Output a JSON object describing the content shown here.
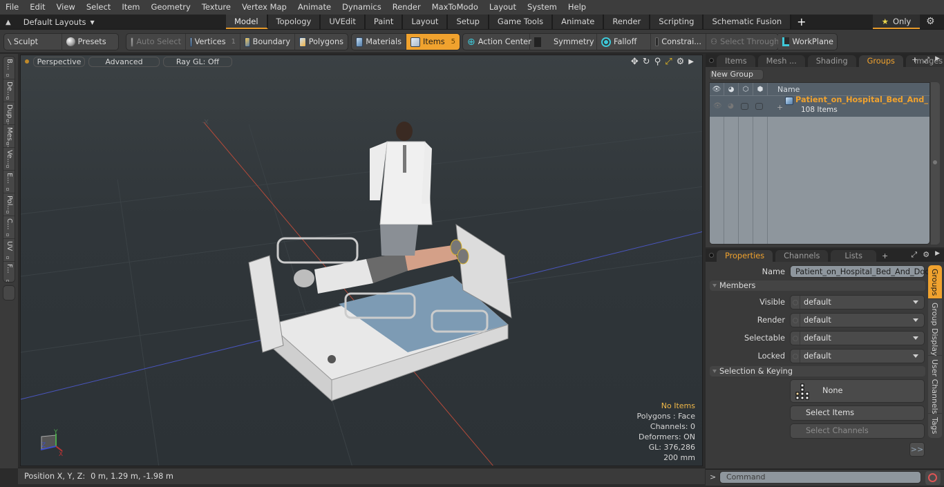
{
  "menu": [
    "File",
    "Edit",
    "View",
    "Select",
    "Item",
    "Geometry",
    "Texture",
    "Vertex Map",
    "Animate",
    "Dynamics",
    "Render",
    "MaxToModo",
    "Layout",
    "System",
    "Help"
  ],
  "layouts": {
    "label": "Default Layouts"
  },
  "layout_tabs": [
    {
      "label": "Model",
      "active": true
    },
    {
      "label": "Topology"
    },
    {
      "label": "UVEdit"
    },
    {
      "label": "Paint"
    },
    {
      "label": "Layout"
    },
    {
      "label": "Setup"
    },
    {
      "label": "Game Tools"
    },
    {
      "label": "Animate"
    },
    {
      "label": "Render"
    },
    {
      "label": "Scripting"
    },
    {
      "label": "Schematic Fusion"
    }
  ],
  "only_label": "Only",
  "toolbar": {
    "sculpt": "Sculpt",
    "presets": "Presets",
    "auto_select": "Auto Select",
    "vertices": "Vertices",
    "vertices_count": "1",
    "boundary": "Boundary",
    "polygons": "Polygons",
    "materials": "Materials",
    "items": "Items",
    "items_count": "5",
    "action_center": "Action Center",
    "symmetry": "Symmetry",
    "falloff": "Falloff",
    "constraints": "Constrai...",
    "select_through": "Select Through",
    "workplane": "WorkPlane"
  },
  "left_tabs": [
    "B...",
    "De...",
    "Dup...",
    "Mes...",
    "Ve...",
    "E...",
    "Pol...",
    "C...",
    "UV",
    "F..."
  ],
  "viewport": {
    "view": "Perspective",
    "shading": "Advanced",
    "raygl": "Ray GL: Off",
    "info": {
      "items": "No Items",
      "polygons": "Polygons : Face",
      "channels": "Channels: 0",
      "deformers": "Deformers: ON",
      "gl": "GL: 376,286",
      "scale": "200 mm"
    }
  },
  "status": {
    "label": "Position X, Y, Z:",
    "value": "0 m, 1.29 m, -1.98 m"
  },
  "groups_panel": {
    "tabs": [
      {
        "label": "Items"
      },
      {
        "label": "Mesh ..."
      },
      {
        "label": "Shading"
      },
      {
        "label": "Groups",
        "active": true
      },
      {
        "label": "Images"
      }
    ],
    "new_group": "New Group",
    "column_name": "Name",
    "rows": [
      {
        "name": "Patient_on_Hospital_Bed_And_ ...",
        "count": "108 Items"
      }
    ]
  },
  "properties_panel": {
    "tabs": [
      {
        "label": "Properties",
        "active": true
      },
      {
        "label": "Channels"
      },
      {
        "label": "Lists"
      }
    ],
    "name_label": "Name",
    "name_value": "Patient_on_Hospital_Bed_And_Doctor",
    "members_section": "Members",
    "fields": [
      {
        "label": "Visible",
        "value": "default"
      },
      {
        "label": "Render",
        "value": "default"
      },
      {
        "label": "Selectable",
        "value": "default"
      },
      {
        "label": "Locked",
        "value": "default"
      }
    ],
    "selection_section": "Selection & Keying",
    "none_label": "None",
    "select_items": "Select Items",
    "select_channels": "Select Channels",
    "more": ">>",
    "side_tabs": [
      {
        "label": "Groups",
        "active": true
      },
      {
        "label": "Group Display"
      },
      {
        "label": "User Channels"
      },
      {
        "label": "Tags"
      }
    ]
  },
  "command": {
    "prompt": ">",
    "placeholder": "Command"
  },
  "colors": {
    "accent": "#f0a22e",
    "info_highlight": "#f0b848",
    "group_name": "#f0a22e"
  }
}
